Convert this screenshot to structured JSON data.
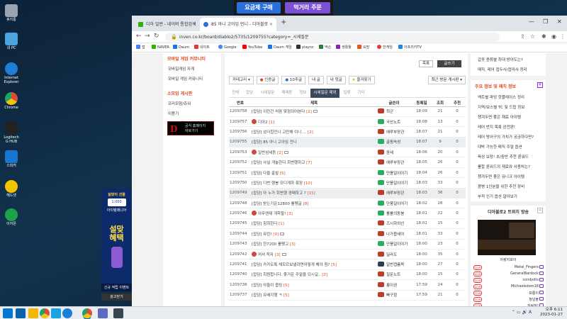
{
  "ad_top": {
    "buy": "요금제 구매",
    "main": "먹거리 주문"
  },
  "desktop_icons": [
    {
      "label": "휴지통",
      "color": "#9aa5b1"
    },
    {
      "label": "내 PC",
      "color": "#4da3e0"
    },
    {
      "label": "Internet Explorer",
      "color": "#1e7ed6"
    },
    {
      "label": "Chrome",
      "color": "#dd4b39"
    },
    {
      "label": "Logitech G HUB",
      "color": "#222222"
    },
    {
      "label": "스피커",
      "color": "#1976d2"
    },
    {
      "label": "헤드셋",
      "color": "#f2c400"
    },
    {
      "label": "이어폰",
      "color": "#1aa34a"
    }
  ],
  "ad_left": {
    "title": "설맞이 선물",
    "amount": "1,000",
    "sub": "아이템매니아",
    "big1": "설맞",
    "big2": "혜택",
    "foot": "신규 적립 이벤트",
    "close": "광고닫기"
  },
  "tabs": [
    {
      "label": "디아 일번 - 네이버 통합검색",
      "active": false
    },
    {
      "label": "85 아니 고아임 언니 - 디아블로",
      "active": true
    }
  ],
  "url": "inven.co.kr/board/diablo2/5735/1209755?category=_시세질문",
  "bookmarks": [
    "앱",
    "NAVER",
    "Daum",
    "네이트",
    "Google",
    "YouTube",
    "Daum 게임",
    "plaync",
    "넥슨",
    "생활툴",
    "요망",
    "한게임",
    "아프리카TV"
  ],
  "left": {
    "section1": "모바일 게임 커뮤니티",
    "items1": [
      "모바일게임 자게",
      "모바일 게임 커뮤니티"
    ],
    "section2": "소모임 게시판",
    "items2": [
      "프리모험/쥬워",
      "이용기"
    ],
    "banner_title": "공식 홈페이지",
    "banner_sub": "바로가기"
  },
  "main": {
    "btn_list": "목록",
    "btn_write": "글쓰기",
    "filters": [
      "카테고리",
      "인증글",
      "10추글",
      "내 글",
      "내 댓글",
      "즐겨찾기"
    ],
    "sort": "최근 방문 게시판",
    "categories": [
      "전체",
      "잡담",
      "시세질문",
      "패래톤",
      "정보",
      "시세질문 제외",
      "팁류",
      "기타"
    ],
    "active_category": 5,
    "headers": {
      "num": "번호",
      "title": "제목",
      "author": "글쓴이",
      "date": "등록일",
      "views": "조회",
      "rec": "추천"
    },
    "rows": [
      {
        "num": "1209758",
        "title": "[잡담] 이런건 처음 맞점되어본다",
        "cmt": "[2]",
        "pic": true,
        "avatar": false,
        "author": "최군",
        "lvcolor": "#c0392b",
        "date": "18:09",
        "views": "21",
        "rec": "0",
        "hl": false
      },
      {
        "num": "1209757",
        "title": "디아2",
        "cmt": "[1]",
        "pic": false,
        "avatar": true,
        "author": "국산노트",
        "lvcolor": "#27ae60",
        "date": "18:08",
        "views": "13",
        "rec": "0",
        "hl": false
      },
      {
        "num": "1209756",
        "title": "[잡담] 샀더힙언니 고민해 이니 ...",
        "cmt": "[2]",
        "pic": false,
        "avatar": false,
        "author": "에루부장관",
        "lvcolor": "#c0392b",
        "date": "18:07",
        "views": "21",
        "rec": "0",
        "hl": false
      },
      {
        "num": "1209755",
        "title": "[잡담] 85 아니 고아임 언니",
        "cmt": "",
        "pic": false,
        "avatar": false,
        "author": "골핑속성",
        "lvcolor": "#27ae60",
        "date": "18:07",
        "views": "9",
        "rec": "0",
        "hl": true
      },
      {
        "num": "1209753",
        "title": "일번섬세등",
        "cmt": "[2]",
        "pic": true,
        "avatar": true,
        "author": "윤세",
        "lvcolor": "#c0392b",
        "date": "18:06",
        "views": "20",
        "rec": "0",
        "hl": false
      },
      {
        "num": "1209752",
        "title": "[잡담] 사실 개놀한다 회변했하고",
        "cmt": "[7]",
        "pic": false,
        "avatar": false,
        "author": "에루부장관",
        "lvcolor": "#c0392b",
        "date": "18:05",
        "views": "26",
        "rec": "0",
        "hl": false
      },
      {
        "num": "1209751",
        "title": "[잡담] 다들 출발",
        "cmt": "[5]",
        "pic": false,
        "avatar": false,
        "author": "단풍일이야기",
        "lvcolor": "#27ae60",
        "date": "18:04",
        "views": "26",
        "rec": "0",
        "hl": false
      },
      {
        "num": "1209750",
        "title": "[잡담] 디번 행봉 모디게하 폭장",
        "cmt": "[10]",
        "pic": false,
        "avatar": false,
        "author": "단풍일이야기",
        "lvcolor": "#27ae60",
        "date": "18:03",
        "views": "33",
        "rec": "0",
        "hl": false
      },
      {
        "num": "1209749",
        "title": "[잡담] 아 누가 회변했 경패하고 ?",
        "cmt": "[15]",
        "pic": false,
        "avatar": false,
        "author": "에루부장관",
        "lvcolor": "#c0392b",
        "date": "18:03",
        "views": "36",
        "rec": "0",
        "hl": true
      },
      {
        "num": "1209748",
        "title": "[잡담] 받는기운12800 룰펭글",
        "cmt": "[8]",
        "pic": false,
        "avatar": false,
        "author": "단풍일이야기",
        "lvcolor": "#27ae60",
        "date": "18:02",
        "views": "28",
        "rec": "0",
        "hl": false
      },
      {
        "num": "1209746",
        "title": "아무엔제 개학할!",
        "cmt": "[3]",
        "pic": false,
        "avatar": true,
        "author": "롤롤의동봉",
        "lvcolor": "#27ae60",
        "date": "18:01",
        "views": "22",
        "rec": "0",
        "hl": false
      },
      {
        "num": "1209745",
        "title": "[잡담] 힘회한다",
        "cmt": "[1]",
        "pic": false,
        "avatar": false,
        "author": "즈시하외신",
        "lvcolor": "#c0392b",
        "date": "18:01",
        "views": "15",
        "rec": "0",
        "hl": false
      },
      {
        "num": "1209744",
        "title": "[잡담] 뮤린!",
        "cmt": "[9]",
        "pic": true,
        "avatar": false,
        "author": "나가봅세야",
        "lvcolor": "#c0392b",
        "date": "18:01",
        "views": "33",
        "rec": "0",
        "hl": false
      },
      {
        "num": "1209743",
        "title": "[잡담] 한7200 룰펭고",
        "cmt": "[3]",
        "pic": false,
        "avatar": false,
        "author": "단풍일이야기",
        "lvcolor": "#27ae60",
        "date": "18:00",
        "views": "23",
        "rec": "0",
        "hl": false
      },
      {
        "num": "1209742",
        "title": "져셔 득자",
        "cmt": "[3]",
        "pic": true,
        "avatar": true,
        "author": "딜라도",
        "lvcolor": "#c0392b",
        "date": "18:00",
        "views": "35",
        "rec": "0",
        "hl": false
      },
      {
        "num": "1209741",
        "title": "[잡담] 카카오톡 채모르보낼려면어떻게 해야 됨?",
        "cmt": "[5]",
        "pic": false,
        "avatar": false,
        "author": "일번캡륨팍",
        "lvcolor": "#2c3e50",
        "date": "18:00",
        "views": "27",
        "rec": "0",
        "hl": false
      },
      {
        "num": "1209740",
        "title": "[잡담] 회원합니다. 좋거운 주말을 되시길..",
        "cmt": "[2]",
        "pic": false,
        "avatar": false,
        "author": "질문노트",
        "lvcolor": "#c0392b",
        "date": "18:00",
        "views": "15",
        "rec": "0",
        "hl": false
      },
      {
        "num": "1209738",
        "title": "[잡담] 아들이 옵팅",
        "cmt": "[5]",
        "pic": false,
        "avatar": false,
        "author": "롱이권",
        "lvcolor": "#c0392b",
        "date": "17:59",
        "views": "24",
        "rec": "0",
        "hl": false
      },
      {
        "num": "1209737",
        "title": "[잡담] 유배지행 ㅋ",
        "cmt": "[5]",
        "pic": false,
        "avatar": false,
        "author": "빠구헝",
        "lvcolor": "#c0392b",
        "date": "17:59",
        "views": "21",
        "rec": "0",
        "hl": false
      }
    ]
  },
  "right": {
    "top_lines": [
      "갑옷 종류별 최대 방어도는?",
      "매직, 레어 접두사/접미사 정리"
    ],
    "section1": "주요 정보 및 패치 정보",
    "lines1": [
      "액트별 파밍 핫플레이스 정리",
      "지역/보스별 TC 및 드랍 정보",
      "챙겨두면 좋은 재료 아이템",
      "레어 반지 목록 완전판!",
      "레어 방어구의 가치가 궁금하다면?",
      "대박 가능한 매직 주얼 옵션",
      "육성 보장! 초/중반 추천 룬워드",
      "룰합 룬워드의 재료와 사용처는?",
      "챙겨두면 좋은 유니크 아이템",
      "용병 1인분을 위한 추천 장비",
      "부적 인기 옵션 알아보기"
    ],
    "section2": "디아블로2 트위치 방송",
    "stream_caption": "아랑지보이",
    "live_tag": "Live",
    "streamers": [
      "Metal_Fingers",
      "GeneralBardock",
      "coinbolts",
      "Michaelsdom18",
      "보롱이",
      "청널블",
      "밀링빌!"
    ]
  },
  "clock": {
    "time": "오후 6:11",
    "date": "2023-01-27"
  }
}
